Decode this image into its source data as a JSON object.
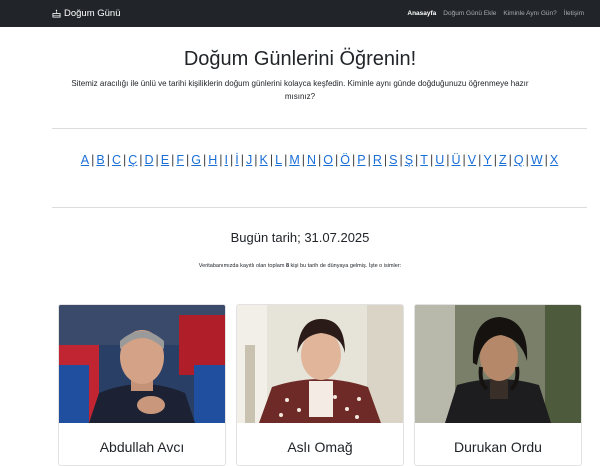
{
  "nav": {
    "brand": "Doğum Günü",
    "links": [
      {
        "label": "Anasayfa",
        "active": true
      },
      {
        "label": "Doğum Günü Ekle",
        "active": false
      },
      {
        "label": "Kiminle Aynı Gün?",
        "active": false
      },
      {
        "label": "İletişim",
        "active": false
      }
    ]
  },
  "hero": {
    "title": "Doğum Günlerini Öğrenin!",
    "lead": "Sitemiz aracılığı ile ünlü ve tarihi kişiliklerin doğum günlerini kolayca keşfedin. Kiminle aynı günde doğduğunuzu öğrenmeye hazır mısınız?"
  },
  "alphabet": [
    "A",
    "B",
    "C",
    "Ç",
    "D",
    "E",
    "F",
    "G",
    "H",
    "I",
    "İ",
    "J",
    "K",
    "L",
    "M",
    "N",
    "O",
    "Ö",
    "P",
    "R",
    "S",
    "Ş",
    "T",
    "U",
    "Ü",
    "V",
    "Y",
    "Z",
    "Q",
    "W",
    "X"
  ],
  "today": "Bugün tarih; 31.07.2025",
  "info": {
    "before": "Veritabanımızda kayıtlı olan toplam ",
    "count": "8",
    "after": " kişi bu tarih de dünyaya gelmiş. İşte o isimler:"
  },
  "people": [
    {
      "name": "Abdullah Avcı"
    },
    {
      "name": "Aslı Omağ"
    },
    {
      "name": "Durukan Ordu"
    }
  ],
  "colors": {
    "navbar": "#212529",
    "link": "#1a6fd6"
  },
  "icons": {
    "brand": "birthday-cake-icon"
  }
}
